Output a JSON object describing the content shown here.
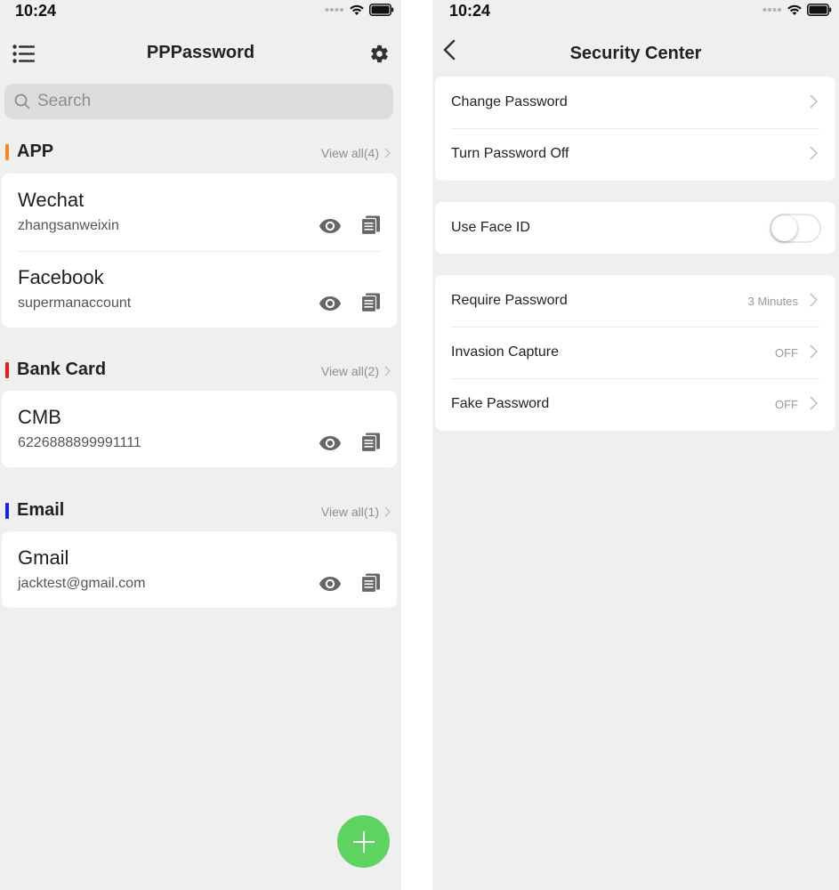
{
  "left": {
    "status": {
      "time": "10:24"
    },
    "nav": {
      "title": "PPPassword",
      "menu_icon": "list-icon",
      "settings_icon": "gear-icon"
    },
    "search": {
      "placeholder": "Search"
    },
    "sections": [
      {
        "title": "APP",
        "color": "#f08a24",
        "view_all": "View all(4)",
        "entries": [
          {
            "title": "Wechat",
            "subtitle": "zhangsanweixin"
          },
          {
            "title": "Facebook",
            "subtitle": "supermanaccount"
          }
        ]
      },
      {
        "title": "Bank Card",
        "color": "#e02020",
        "view_all": "View all(2)",
        "entries": [
          {
            "title": "CMB",
            "subtitle": "6226888899991111"
          }
        ]
      },
      {
        "title": "Email",
        "color": "#2020e0",
        "view_all": "View all(1)",
        "entries": [
          {
            "title": "Gmail",
            "subtitle": "jacktest@gmail.com"
          }
        ]
      }
    ],
    "fab": {
      "icon": "plus-icon",
      "color": "#5fd35f"
    }
  },
  "right": {
    "status": {
      "time": "10:24"
    },
    "nav": {
      "title": "Security Center",
      "back_icon": "chevron-left-icon"
    },
    "groups": [
      {
        "rows": [
          {
            "label": "Change Password",
            "value": ""
          },
          {
            "label": "Turn Password Off",
            "value": ""
          }
        ]
      },
      {
        "rows": [
          {
            "label": "Use Face ID",
            "toggle": false
          }
        ]
      },
      {
        "rows": [
          {
            "label": "Require Password",
            "value": "3 Minutes"
          },
          {
            "label": "Invasion Capture",
            "value": "OFF"
          },
          {
            "label": "Fake Password",
            "value": "OFF"
          }
        ]
      }
    ]
  }
}
